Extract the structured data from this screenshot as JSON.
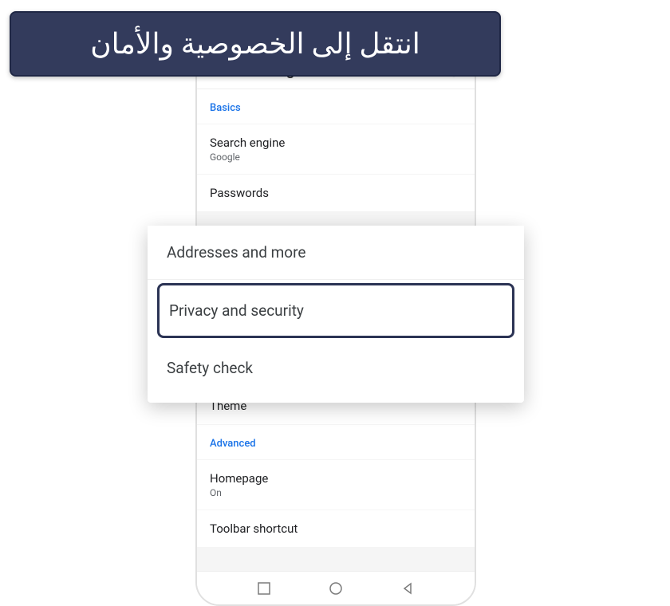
{
  "banner": {
    "text": "انتقل إلى الخصوصية والأمان"
  },
  "header": {
    "title": "Settings"
  },
  "sections": {
    "basics": {
      "label": "Basics",
      "items": {
        "search_engine": {
          "title": "Search engine",
          "subtitle": "Google"
        },
        "passwords": {
          "title": "Passwords"
        },
        "theme": {
          "title": "Theme"
        }
      }
    },
    "advanced": {
      "label": "Advanced",
      "items": {
        "homepage": {
          "title": "Homepage",
          "subtitle": "On"
        },
        "toolbar": {
          "title": "Toolbar shortcut"
        }
      }
    }
  },
  "callout": {
    "addresses": "Addresses and more",
    "privacy": "Privacy and security",
    "safety": "Safety check"
  }
}
